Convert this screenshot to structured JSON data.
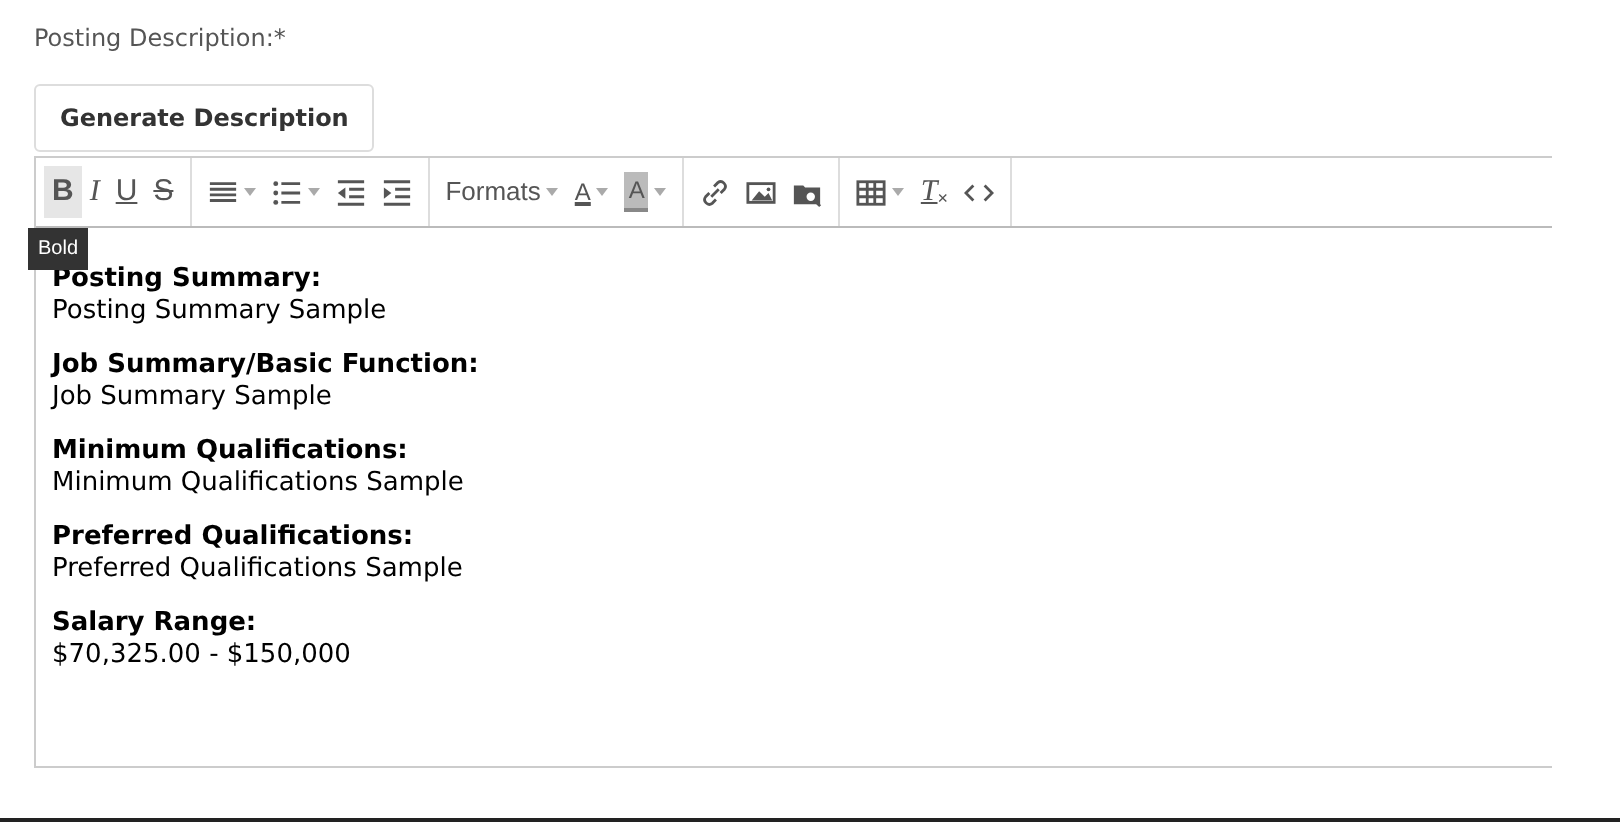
{
  "field_label": "Posting Description:*",
  "generate_button": "Generate Description",
  "toolbar": [
    [
      {
        "kind": "bold",
        "text": "B",
        "hovered": true
      },
      {
        "kind": "italic",
        "text": "I",
        "hovered": false
      },
      {
        "kind": "underline",
        "text": "U",
        "hovered": false
      },
      {
        "kind": "strike",
        "text": "S",
        "hovered": false
      }
    ],
    [
      {
        "kind": "align",
        "dropdown": true
      },
      {
        "kind": "bullets",
        "dropdown": true
      },
      {
        "kind": "outdent",
        "dropdown": false
      },
      {
        "kind": "indent",
        "dropdown": false
      }
    ],
    [
      {
        "kind": "formats",
        "text": "Formats",
        "dropdown": true
      },
      {
        "kind": "forecolor",
        "text": "A",
        "dropdown": true
      },
      {
        "kind": "backcolor",
        "text": "A",
        "dropdown": true
      }
    ],
    [
      {
        "kind": "link",
        "dropdown": false
      },
      {
        "kind": "image",
        "dropdown": false
      },
      {
        "kind": "media",
        "dropdown": false
      }
    ],
    [
      {
        "kind": "table",
        "dropdown": true
      },
      {
        "kind": "clear",
        "text": "T",
        "sub": "×",
        "dropdown": false
      },
      {
        "kind": "code",
        "dropdown": false
      }
    ]
  ],
  "tooltip": "Bold",
  "sections": [
    {
      "heading": "Posting Summary:",
      "body": "Posting Summary Sample"
    },
    {
      "heading": "Job Summary/Basic Function:",
      "body": "Job Summary Sample"
    },
    {
      "heading": "Minimum Qualifications:",
      "body": "Minimum Qualifications Sample"
    },
    {
      "heading": "Preferred Qualifications:",
      "body": "Preferred Qualifications Sample"
    },
    {
      "heading": "Salary Range:",
      "body": "$70,325.00 - $150,000"
    }
  ]
}
